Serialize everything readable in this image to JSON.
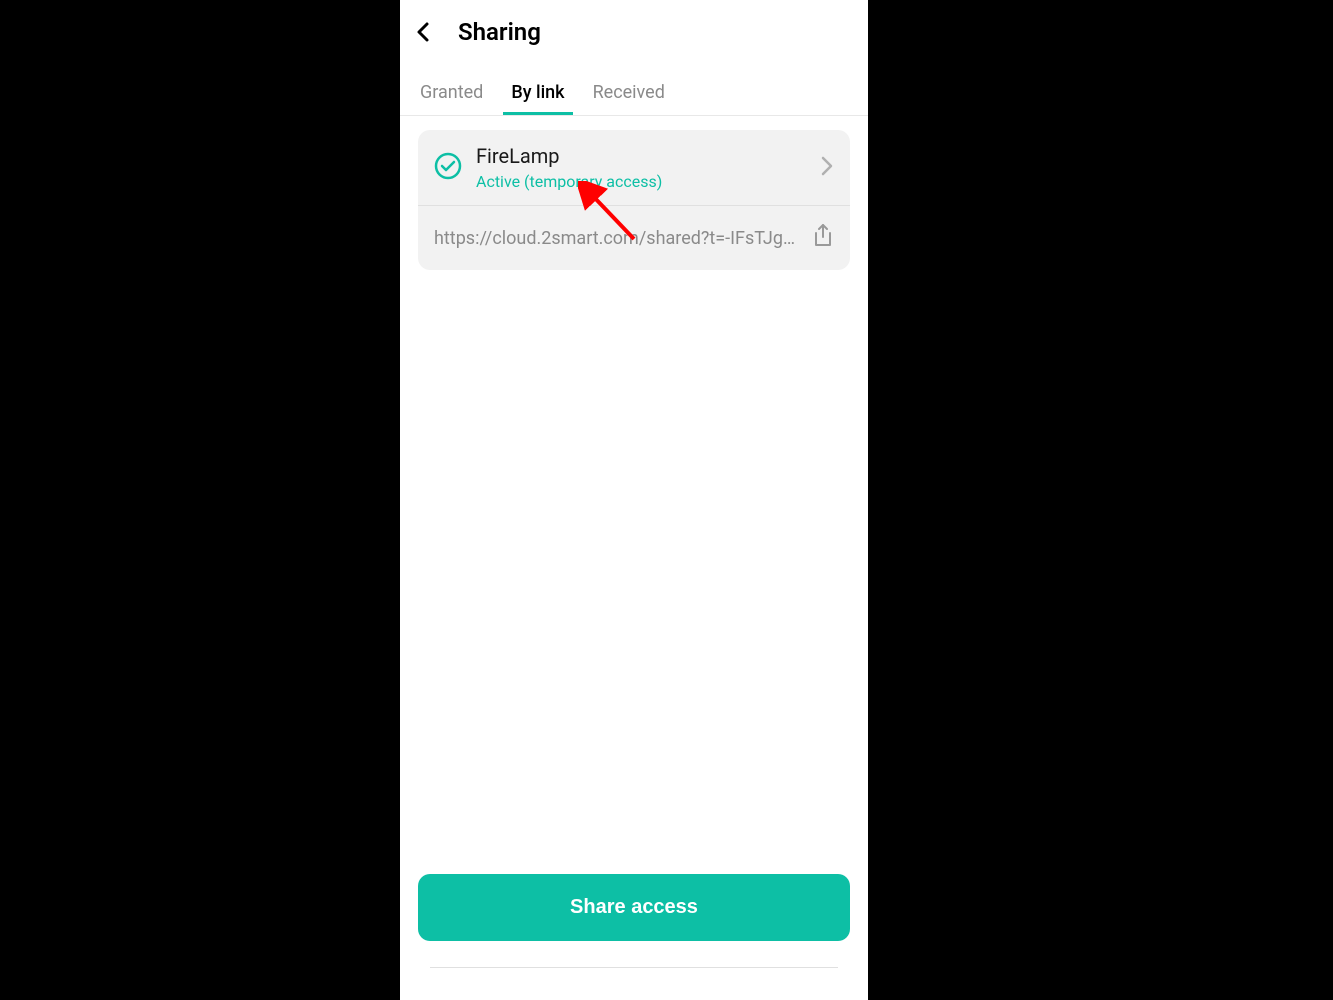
{
  "header": {
    "title": "Sharing"
  },
  "tabs": {
    "granted": "Granted",
    "by_link": "By link",
    "received": "Received"
  },
  "card": {
    "title": "FireLamp",
    "status": "Active (temporary access)",
    "link": "https://cloud.2smart.com/shared?t=-IFsTJg…"
  },
  "button": {
    "share_label": "Share access"
  },
  "colors": {
    "accent": "#0dbfa5"
  }
}
